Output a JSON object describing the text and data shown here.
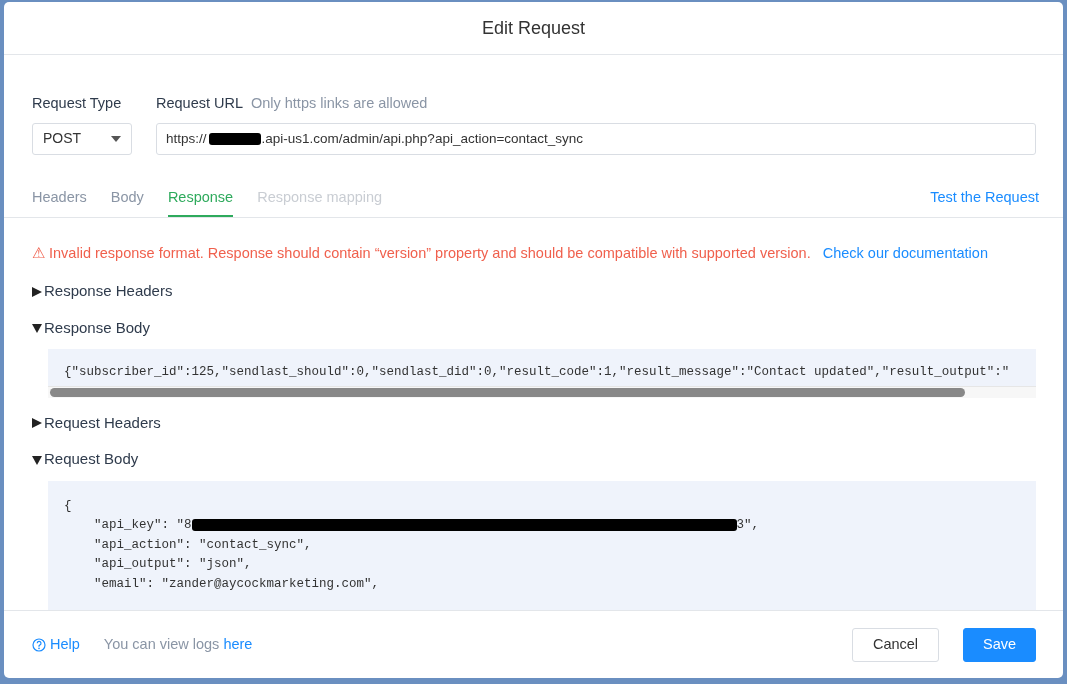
{
  "window": {
    "title": "Edit Request"
  },
  "request_type": {
    "label": "Request Type",
    "value": "POST"
  },
  "request_url": {
    "label": "Request URL",
    "hint": "Only https links are allowed",
    "prefix": "https://",
    "redacted": true,
    "suffix": ".api-us1.com/admin/api.php?api_action=contact_sync"
  },
  "tabs": [
    {
      "label": "Headers",
      "selected": false,
      "disabled": false
    },
    {
      "label": "Body",
      "selected": false,
      "disabled": false
    },
    {
      "label": "Response",
      "selected": true,
      "disabled": false
    },
    {
      "label": "Response mapping",
      "selected": false,
      "disabled": true
    }
  ],
  "test_link": "Test the Request",
  "error": {
    "icon": "⚠",
    "message": "Invalid response format. Response should contain “version” property and should be compatible with supported version.",
    "link": "Check our documentation"
  },
  "sections": [
    {
      "title": "Response Headers",
      "expanded": false
    },
    {
      "title": "Response Body",
      "expanded": true,
      "scroll": true,
      "lines": [
        {
          "text": "{\"subscriber_id\":125,\"sendlast_should\":0,\"sendlast_did\":0,\"result_code\":1,\"result_message\":\"Contact updated\",\"result_output\":\""
        }
      ]
    },
    {
      "title": "Request Headers",
      "expanded": false
    },
    {
      "title": "Request Body",
      "expanded": true,
      "lines": [
        {
          "text": "{"
        },
        {
          "text": "    \"api_key\": \"8",
          "redacted": true,
          "after": "3\","
        },
        {
          "text": "    \"api_action\": \"contact_sync\","
        },
        {
          "text": "    \"api_output\": \"json\","
        },
        {
          "text": "    \"email\": \"zander@aycockmarketing.com\","
        }
      ]
    }
  ],
  "footer": {
    "help": "Help",
    "logs_text": "You can view logs",
    "logs_link": "here",
    "buttons": [
      {
        "label": "Cancel",
        "kind": "secondary"
      },
      {
        "label": "Save",
        "kind": "primary"
      }
    ]
  }
}
